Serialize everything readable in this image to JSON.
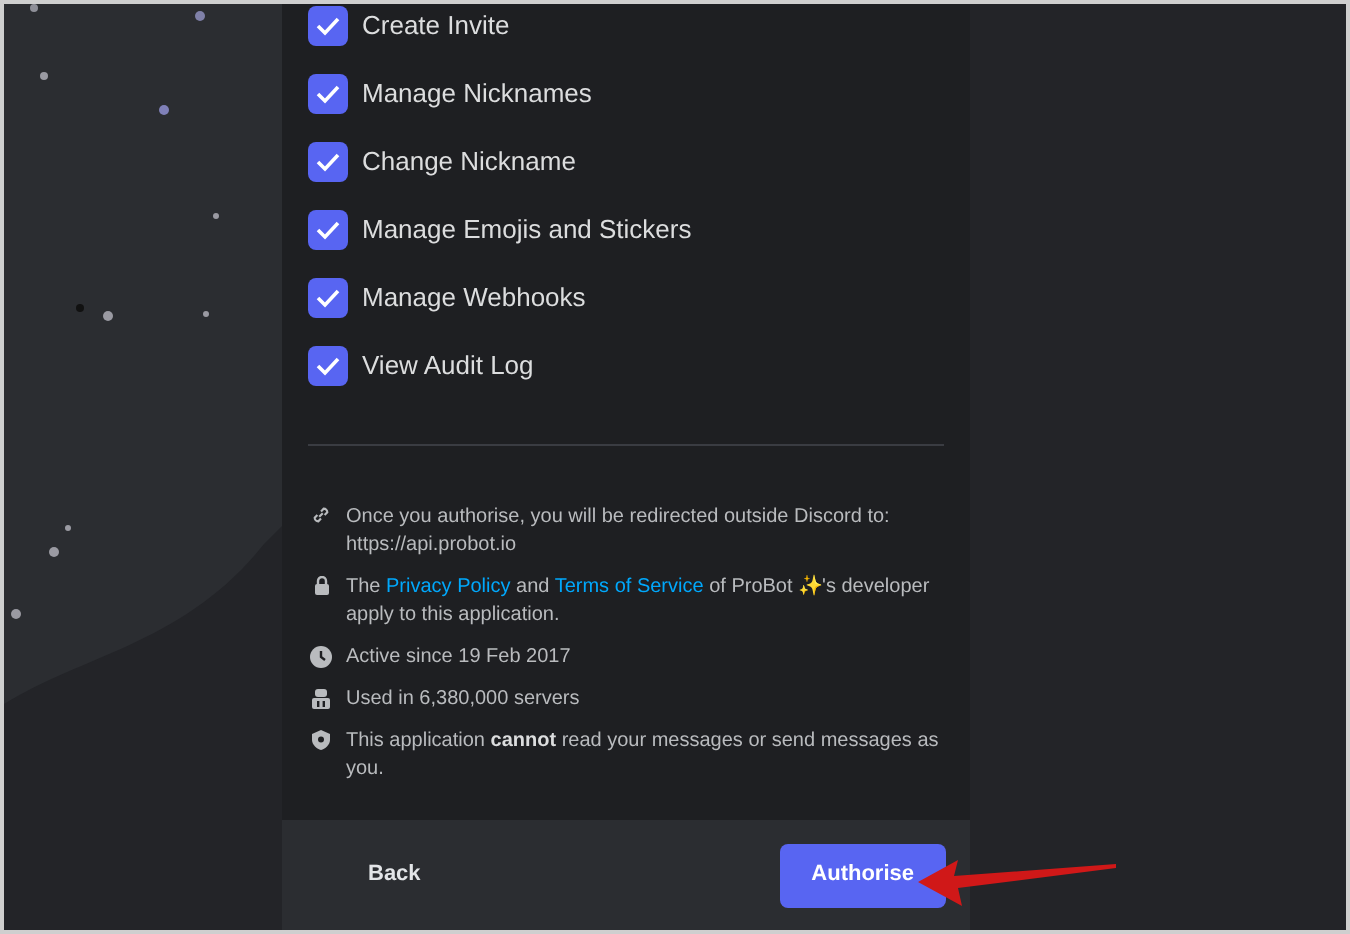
{
  "permissions": [
    {
      "label": "Create Invite",
      "checked": true
    },
    {
      "label": "Manage Nicknames",
      "checked": true
    },
    {
      "label": "Change Nickname",
      "checked": true
    },
    {
      "label": "Manage Emojis and Stickers",
      "checked": true
    },
    {
      "label": "Manage Webhooks",
      "checked": true
    },
    {
      "label": "View Audit Log",
      "checked": true
    }
  ],
  "info": [
    {
      "kind": "redirect",
      "parts": [
        {
          "kind": "text",
          "text": "Once you authorise, you will be redirected outside Discord to: https://api.probot.io"
        }
      ]
    },
    {
      "kind": "policy",
      "parts": [
        {
          "kind": "text",
          "text": "The "
        },
        {
          "kind": "link",
          "text": "Privacy Policy"
        },
        {
          "kind": "text",
          "text": " and "
        },
        {
          "kind": "link",
          "text": "Terms of Service"
        },
        {
          "kind": "text",
          "text": " of ProBot ✨'s developer apply to this application."
        }
      ]
    },
    {
      "kind": "active",
      "parts": [
        {
          "kind": "text",
          "text": "Active since 19 Feb 2017"
        }
      ]
    },
    {
      "kind": "servers",
      "parts": [
        {
          "kind": "text",
          "text": "Used in 6,380,000 servers"
        }
      ]
    },
    {
      "kind": "permission",
      "parts": [
        {
          "kind": "text",
          "text": "This application **cannot** read your messages or send messages as you."
        }
      ]
    }
  ],
  "footer": {
    "back": "Back",
    "authorise": "Authorise"
  }
}
